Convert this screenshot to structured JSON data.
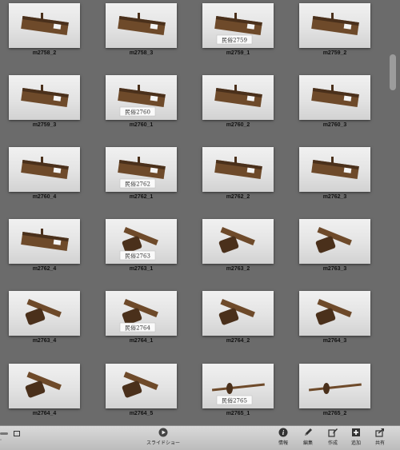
{
  "photos": [
    {
      "caption": "m2758_2",
      "kind": "plane",
      "label": ""
    },
    {
      "caption": "m2758_3",
      "kind": "plane",
      "label": ""
    },
    {
      "caption": "m2759_1",
      "kind": "plane",
      "label": "民俗2759"
    },
    {
      "caption": "m2759_2",
      "kind": "plane",
      "label": ""
    },
    {
      "caption": "m2759_3",
      "kind": "plane",
      "label": ""
    },
    {
      "caption": "m2760_1",
      "kind": "plane",
      "label": "民俗2760"
    },
    {
      "caption": "m2760_2",
      "kind": "plane",
      "label": ""
    },
    {
      "caption": "m2760_3",
      "kind": "plane",
      "label": ""
    },
    {
      "caption": "m2760_4",
      "kind": "plane",
      "label": ""
    },
    {
      "caption": "m2762_1",
      "kind": "plane",
      "label": "民俗2762"
    },
    {
      "caption": "m2762_2",
      "kind": "plane",
      "label": ""
    },
    {
      "caption": "m2762_3",
      "kind": "plane",
      "label": ""
    },
    {
      "caption": "m2762_4",
      "kind": "plane",
      "label": ""
    },
    {
      "caption": "m2763_1",
      "kind": "gauge",
      "label": "民俗2763"
    },
    {
      "caption": "m2763_2",
      "kind": "gauge",
      "label": ""
    },
    {
      "caption": "m2763_3",
      "kind": "gauge",
      "label": ""
    },
    {
      "caption": "m2763_4",
      "kind": "gauge",
      "label": ""
    },
    {
      "caption": "m2764_1",
      "kind": "gauge",
      "label": "民俗2764"
    },
    {
      "caption": "m2764_2",
      "kind": "gauge",
      "label": ""
    },
    {
      "caption": "m2764_3",
      "kind": "gauge",
      "label": ""
    },
    {
      "caption": "m2764_4",
      "kind": "gauge",
      "label": ""
    },
    {
      "caption": "m2764_5",
      "kind": "gauge",
      "label": ""
    },
    {
      "caption": "m2765_1",
      "kind": "rod",
      "label": "民俗2765"
    },
    {
      "caption": "m2765_2",
      "kind": "rod",
      "label": ""
    }
  ],
  "toolbar": {
    "slideshow": "スライドショー",
    "info": "情報",
    "edit": "編集",
    "create": "作成",
    "add": "追加",
    "share": "共有"
  },
  "icons": {
    "slideshow": "play-icon",
    "info": "info-icon",
    "edit": "pencil-icon",
    "create": "create-icon",
    "add": "plus-icon",
    "share": "share-icon"
  },
  "colors": {
    "background": "#6b6b6b",
    "wood": "#6e4a2a",
    "wood_dark": "#4a301b"
  }
}
